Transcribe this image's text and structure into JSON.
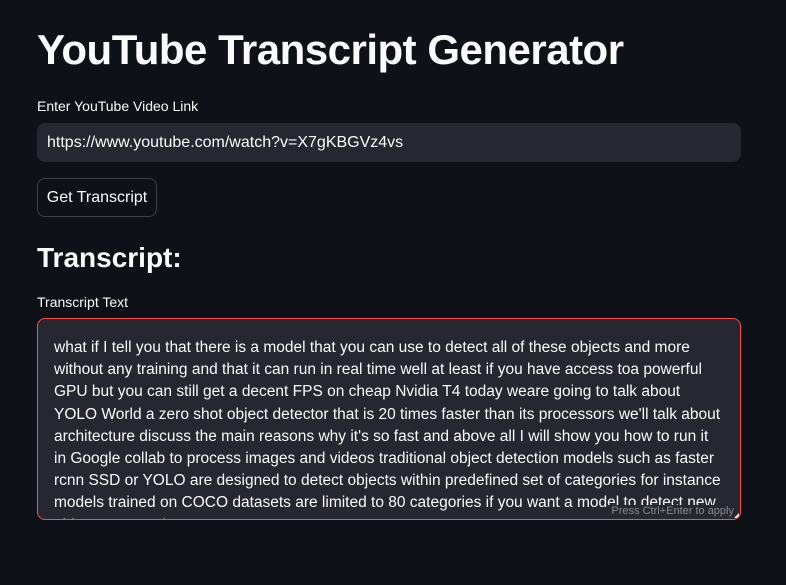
{
  "app": {
    "title": "YouTube Transcript Generator"
  },
  "url_field": {
    "label": "Enter YouTube Video Link",
    "value": "https://www.youtube.com/watch?v=X7gKBGVz4vs"
  },
  "get_button": {
    "label": "Get Transcript"
  },
  "transcript_section": {
    "heading": "Transcript:",
    "label": "Transcript Text",
    "text": "what if I tell you that there is a model that you can use to detect all of these objects and more without any training and that it can run in real time well at least if you have access toa powerful GPU but you can still get a decent FPS on cheap Nvidia T4 today weare going to talk about YOLO World a zero shot object detector that is 20 times faster than its processors we'll talk about architecture discuss the main reasons why it's so fast and above all I will show you how to run it in Google collab to process images and videos traditional object detection models such as faster rcnn SSD or YOLO are designed to detect objects within predefined set of categories for instance models trained on COCO datasets are limited to 80 categories if you want a model to detect new objects we need to",
    "hint": "Press Ctrl+Enter to apply"
  },
  "colors": {
    "background": "#0e1117",
    "input_background": "#262730",
    "focus_border": "#ff4b4b",
    "text": "#fafafa"
  }
}
